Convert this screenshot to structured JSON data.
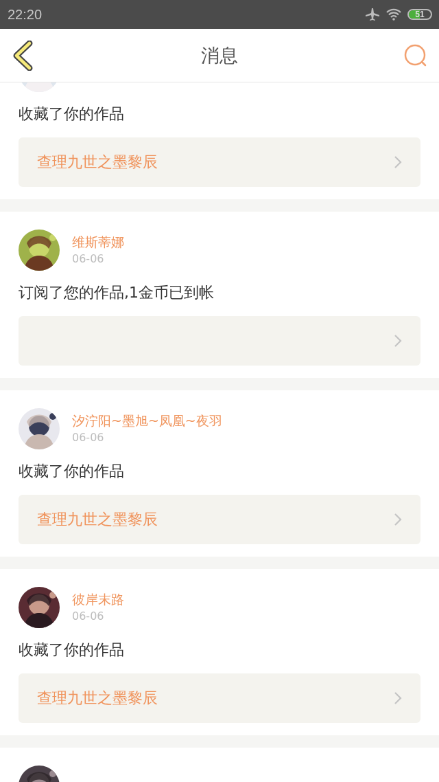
{
  "status_bar": {
    "time": "22:20",
    "battery": "51"
  },
  "header": {
    "title": "消息"
  },
  "messages": [
    {
      "avatar": {
        "kind": "picture"
      },
      "text": "收藏了你的作品",
      "work": "查理九世之墨黎辰"
    },
    {
      "avatar": {
        "kind": "picture"
      },
      "name": "维斯蒂娜",
      "date": "06-06",
      "text": "订阅了您的作品,1金币已到帐"
    },
    {
      "avatar": {
        "kind": "picture"
      },
      "name": "汐泞阳~墨旭~凤凰~夜羽",
      "date": "06-06",
      "text": "收藏了你的作品",
      "work": "查理九世之墨黎辰"
    },
    {
      "avatar": {
        "kind": "picture"
      },
      "name": "彼岸末路",
      "date": "06-06",
      "text": "收藏了你的作品",
      "work": "查理九世之墨黎辰"
    },
    {
      "avatar": {
        "kind": "picture"
      }
    }
  ]
}
